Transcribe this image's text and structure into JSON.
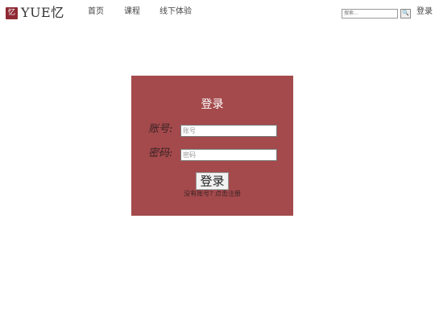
{
  "header": {
    "logo_mark": "忆",
    "logo_text": "YUE忆",
    "nav": [
      "首页",
      "课程",
      "线下体验"
    ],
    "search_placeholder": "搜索...",
    "search_button_icon": "🔍",
    "login": "登录"
  },
  "login_form": {
    "title": "登录",
    "account_label": "账号:",
    "account_placeholder": "账号",
    "password_label": "密码:",
    "password_placeholder": "密码",
    "submit": "登录",
    "no_account_text": "没有账号?",
    "register_link": "点击注册"
  },
  "colors": {
    "panel_background": "#a44a4c",
    "logo_mark": "#8e2a34"
  }
}
